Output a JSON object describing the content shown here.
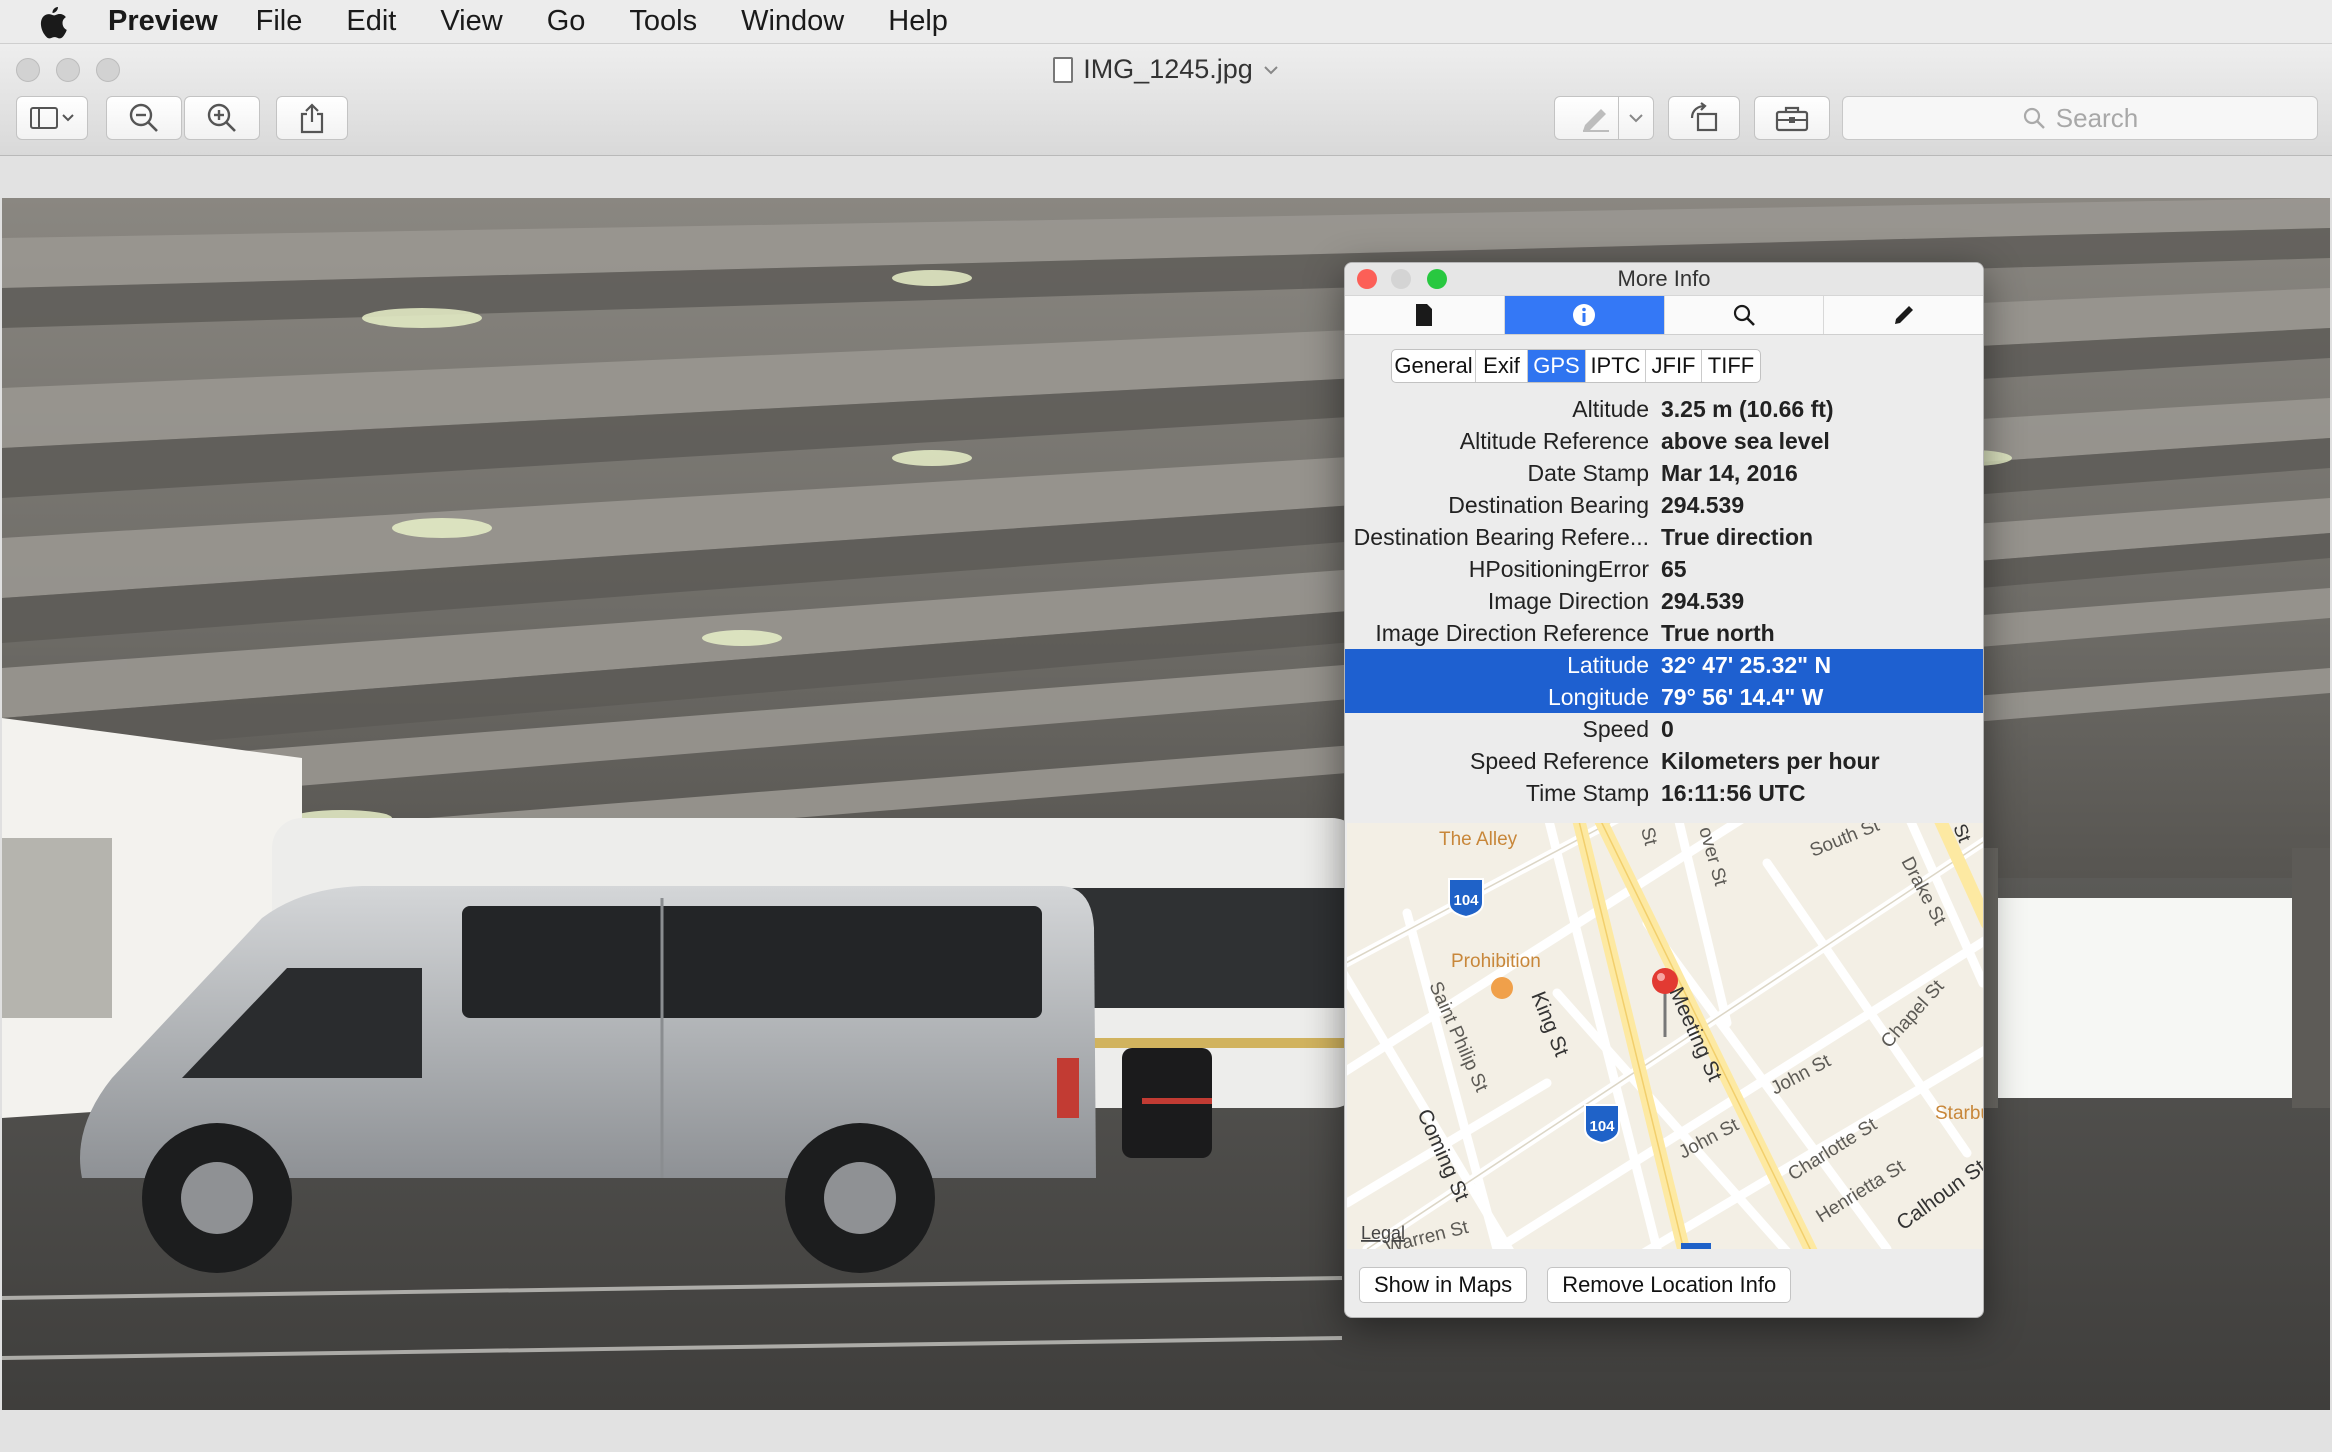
{
  "menubar": {
    "app": "Preview",
    "items": [
      "File",
      "Edit",
      "View",
      "Go",
      "Tools",
      "Window",
      "Help"
    ]
  },
  "window": {
    "title": "IMG_1245.jpg",
    "search_placeholder": "Search"
  },
  "inspector": {
    "title": "More Info",
    "icon_tabs": [
      "document-icon",
      "info-icon",
      "magnifier-icon",
      "pencil-icon"
    ],
    "active_icon_tab": "info-icon",
    "segments": [
      "General",
      "Exif",
      "GPS",
      "IPTC",
      "JFIF",
      "TIFF"
    ],
    "active_segment": "GPS",
    "rows": [
      {
        "key": "Altitude",
        "value": "3.25 m (10.66 ft)"
      },
      {
        "key": "Altitude Reference",
        "value": "above sea level"
      },
      {
        "key": "Date Stamp",
        "value": "Mar 14, 2016"
      },
      {
        "key": "Destination Bearing",
        "value": "294.539"
      },
      {
        "key": "Destination Bearing Refere...",
        "value": "True direction"
      },
      {
        "key": "HPositioningError",
        "value": "65"
      },
      {
        "key": "Image Direction",
        "value": "294.539"
      },
      {
        "key": "Image Direction Reference",
        "value": "True north"
      },
      {
        "key": "Latitude",
        "value": "32° 47' 25.32\" N"
      },
      {
        "key": "Longitude",
        "value": "79° 56' 14.4\" W"
      },
      {
        "key": "Speed",
        "value": "0"
      },
      {
        "key": "Speed Reference",
        "value": "Kilometers per hour"
      },
      {
        "key": "Time Stamp",
        "value": "16:11:56 UTC"
      }
    ],
    "selected_rows": [
      "Latitude",
      "Longitude"
    ],
    "map": {
      "labels": {
        "alley": "The Alley",
        "prohibition": "Prohibition",
        "south": "South St",
        "drake": "Drake St",
        "chapel": "Chapel St",
        "saint_philip": "Saint Philip St",
        "king": "King St",
        "meeting": "Meeting St",
        "john1": "John St",
        "john2": "John St",
        "charlotte": "Charlotte St",
        "henrietta": "Henrietta St",
        "coming": "Coming St",
        "calhoun": "Calhoun St",
        "starbu": "Starbu",
        "warren": "Warren St",
        "st1": "St",
        "over": "over St",
        "st_top_right": "St",
        "route": "104",
        "legal": "Legal"
      }
    },
    "buttons": {
      "show_in_maps": "Show in Maps",
      "remove_location": "Remove Location Info"
    }
  },
  "colors": {
    "accent": "#3478f6",
    "selection": "#1e60d0",
    "close": "#fc5f57",
    "minimize": "#fdbc2e",
    "zoom": "#28c840"
  }
}
